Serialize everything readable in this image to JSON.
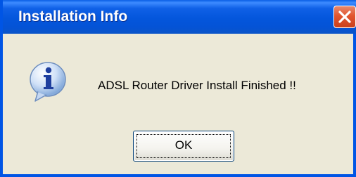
{
  "window": {
    "title": "Installation Info",
    "message": "ADSL Router Driver Install Finished !!",
    "ok_label": "OK"
  },
  "icons": {
    "title_close": "close-icon",
    "dialog_icon": "info-icon"
  },
  "colors": {
    "titlebar": "#0055e5",
    "dialog_background": "#ece9d8",
    "close_button": "#e2552e"
  }
}
